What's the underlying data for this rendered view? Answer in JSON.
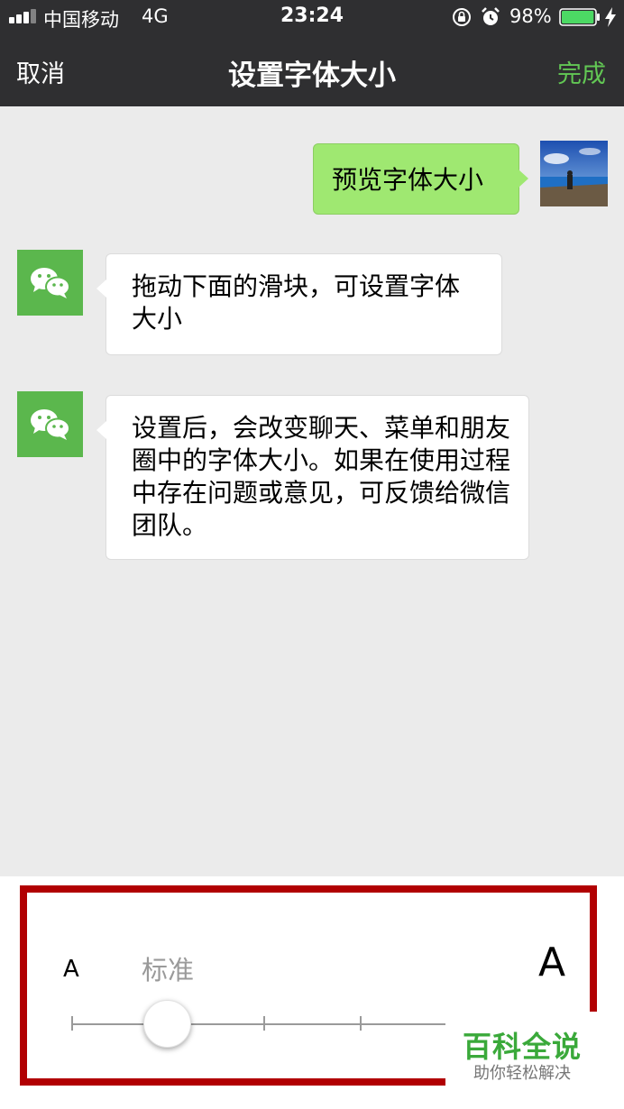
{
  "status_bar": {
    "carrier": "中国移动",
    "network": "4G",
    "time": "23:24",
    "battery_percent": "98%",
    "battery_level": 0.98,
    "icons": [
      "signal-icon",
      "orientation-lock-icon",
      "alarm-icon",
      "battery-icon",
      "charging-icon"
    ]
  },
  "nav": {
    "cancel": "取消",
    "title": "设置字体大小",
    "done": "完成",
    "done_color": "#62c754"
  },
  "chat": {
    "self_message": "预览字体大小",
    "message_1": "拖动下面的滑块，可设置字体大小",
    "message_2": "设置后，会改变聊天、菜单和朋友圈中的字体大小。如果在使用过程中存在问题或意见，可反馈给微信团队。",
    "self_bubble_color": "#9fe871",
    "wechat_avatar_color": "#5bb74d"
  },
  "font_slider": {
    "small_label": "A",
    "current_label": "标准",
    "large_label": "A",
    "selected_step": 1,
    "highlight_color": "#b10002"
  },
  "watermark": {
    "main": "百科全说",
    "sub": "助你轻松解决"
  }
}
